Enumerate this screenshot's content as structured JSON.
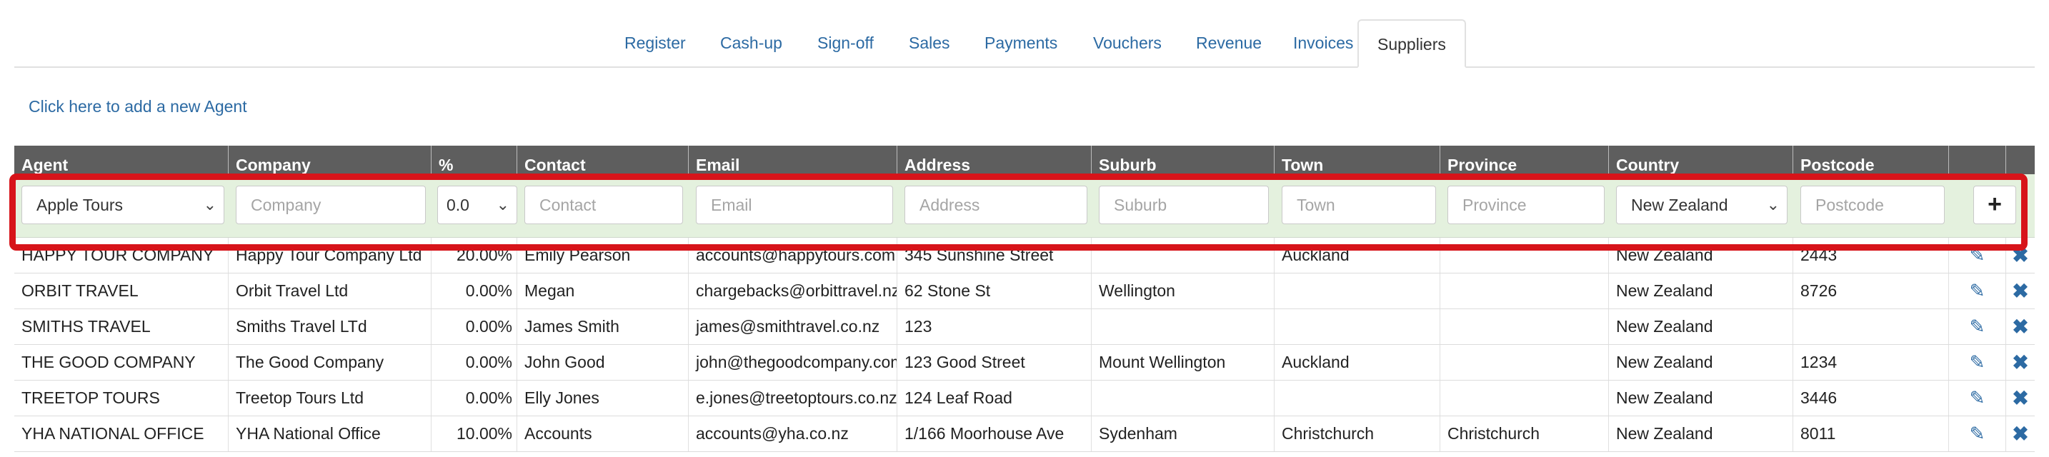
{
  "tabs": [
    "Register",
    "Cash-up",
    "Sign-off",
    "Sales",
    "Payments",
    "Vouchers",
    "Revenue",
    "Invoices",
    "Suppliers"
  ],
  "active_tab": "Suppliers",
  "add_link": "Click here to add a new Agent",
  "columns": [
    "Agent",
    "Company",
    "%",
    "Contact",
    "Email",
    "Address",
    "Suburb",
    "Town",
    "Province",
    "Country",
    "Postcode",
    "",
    ""
  ],
  "form": {
    "agent_value": "Apple Tours",
    "company_placeholder": "Company",
    "percent_value": "0.0",
    "contact_placeholder": "Contact",
    "email_placeholder": "Email",
    "address_placeholder": "Address",
    "suburb_placeholder": "Suburb",
    "town_placeholder": "Town",
    "province_placeholder": "Province",
    "country_value": "New Zealand",
    "postcode_placeholder": "Postcode",
    "add_label": "+"
  },
  "rows": [
    {
      "agent": "HAPPY TOUR COMPANY",
      "company": "Happy Tour Company Ltd",
      "pct": "20.00%",
      "contact": "Emily Pearson",
      "email": "accounts@happytours.com",
      "address": "345 Sunshine Street",
      "suburb": "",
      "town": "Auckland",
      "province": "",
      "country": "New Zealand",
      "postcode": "2443"
    },
    {
      "agent": "ORBIT TRAVEL",
      "company": "Orbit Travel Ltd",
      "pct": "0.00%",
      "contact": "Megan",
      "email": "chargebacks@orbittravel.nz",
      "address": "62 Stone St",
      "suburb": "Wellington",
      "town": "",
      "province": "",
      "country": "New Zealand",
      "postcode": "8726"
    },
    {
      "agent": "SMITHS TRAVEL",
      "company": "Smiths Travel LTd",
      "pct": "0.00%",
      "contact": "James Smith",
      "email": "james@smithtravel.co.nz",
      "address": "123",
      "suburb": "",
      "town": "",
      "province": "",
      "country": "New Zealand",
      "postcode": ""
    },
    {
      "agent": "THE GOOD COMPANY",
      "company": "The Good Company",
      "pct": "0.00%",
      "contact": "John Good",
      "email": "john@thegoodcompany.com",
      "address": "123 Good Street",
      "suburb": "Mount Wellington",
      "town": "Auckland",
      "province": "",
      "country": "New Zealand",
      "postcode": "1234"
    },
    {
      "agent": "TREETOP TOURS",
      "company": "Treetop Tours Ltd",
      "pct": "0.00%",
      "contact": "Elly Jones",
      "email": "e.jones@treetoptours.co.nz",
      "address": "124 Leaf Road",
      "suburb": "",
      "town": "",
      "province": "",
      "country": "New Zealand",
      "postcode": "3446"
    },
    {
      "agent": "YHA NATIONAL OFFICE",
      "company": "YHA National Office",
      "pct": "10.00%",
      "contact": "Accounts",
      "email": "accounts@yha.co.nz",
      "address": "1/166 Moorhouse Ave",
      "suburb": "Sydenham",
      "town": "Christchurch",
      "province": "Christchurch",
      "country": "New Zealand",
      "postcode": "8011"
    }
  ],
  "icons": {
    "edit": "edit-icon",
    "delete": "delete-icon",
    "chevron": "chevron-down-icon",
    "plus": "plus-icon"
  },
  "colors": {
    "header_bg": "#5e5e5e",
    "form_bg": "#e4f1de",
    "link": "#2c6aa3",
    "highlight": "#d7141a"
  }
}
